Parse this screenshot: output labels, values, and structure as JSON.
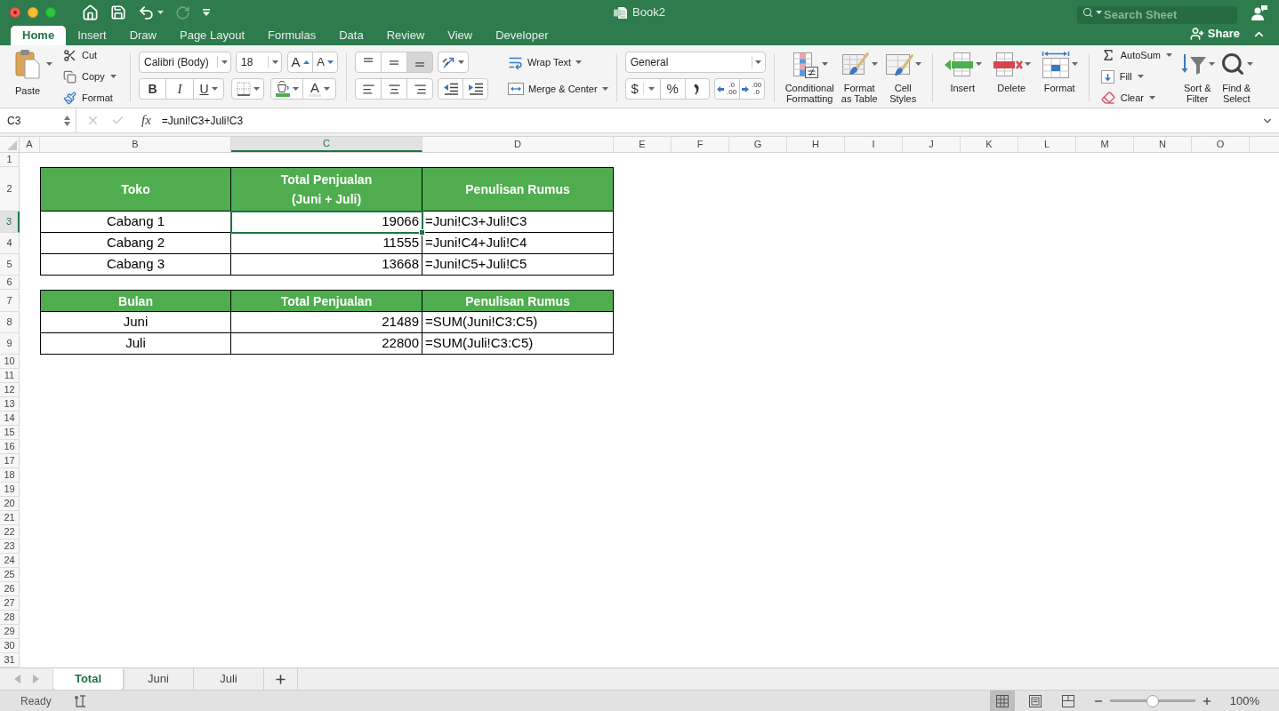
{
  "window": {
    "title": "Book2"
  },
  "quick_access": [
    {
      "kind": "home",
      "disabled": false
    },
    {
      "kind": "save",
      "disabled": false
    },
    {
      "kind": "undo",
      "disabled": false
    },
    {
      "kind": "redo",
      "disabled": true
    },
    {
      "kind": "customize",
      "disabled": false
    }
  ],
  "search": {
    "placeholder": "Search Sheet"
  },
  "share": {
    "label": "Share"
  },
  "ribbon_tabs": [
    {
      "label": "Home",
      "selected": true
    },
    {
      "label": "Insert",
      "selected": false
    },
    {
      "label": "Draw",
      "selected": false
    },
    {
      "label": "Page Layout",
      "selected": false
    },
    {
      "label": "Formulas",
      "selected": false
    },
    {
      "label": "Data",
      "selected": false
    },
    {
      "label": "Review",
      "selected": false
    },
    {
      "label": "View",
      "selected": false
    },
    {
      "label": "Developer",
      "selected": false
    }
  ],
  "clipboard": {
    "paste": "Paste",
    "cut": "Cut",
    "copy": "Copy",
    "format": "Format"
  },
  "font": {
    "name": "Calibri (Body)",
    "size": "18",
    "grow": "A",
    "shrink": "A",
    "bold": "B",
    "italic": "I",
    "underline": "U",
    "foreground": "A"
  },
  "alignment": {
    "vertical": [
      {
        "kind": "top",
        "selected": false
      },
      {
        "kind": "middle",
        "selected": false
      },
      {
        "kind": "bottom",
        "selected": true
      }
    ],
    "horizontal": [
      {
        "kind": "left",
        "selected": false
      },
      {
        "kind": "center",
        "selected": false
      },
      {
        "kind": "right",
        "selected": false
      }
    ],
    "wrap_text": "Wrap Text",
    "merge": "Merge & Center"
  },
  "number": {
    "format": "General",
    "currency": "$",
    "percent": "%",
    "increase_decimal": [
      ".0",
      ".00"
    ],
    "decrease_decimal": [
      ".00",
      ".0"
    ]
  },
  "styles": [
    {
      "kind": "conditional",
      "label": "Conditional\nFormatting"
    },
    {
      "kind": "table",
      "label": "Format\nas Table"
    },
    {
      "kind": "cell",
      "label": "Cell\nStyles"
    }
  ],
  "cells": [
    {
      "kind": "insert",
      "label": "Insert"
    },
    {
      "kind": "delete",
      "label": "Delete"
    },
    {
      "kind": "format",
      "label": "Format"
    }
  ],
  "editing": {
    "autosum": "AutoSum",
    "fill": "Fill",
    "clear": "Clear",
    "sort": "Sort &\nFilter",
    "find": "Find &\nSelect"
  },
  "formula_bar": {
    "name_box": "C3",
    "function_label": "fx",
    "formula": "=Juni!C3+Juli!C3"
  },
  "sheet": {
    "columns": [
      {
        "label": "A",
        "selected": false
      },
      {
        "label": "B",
        "selected": false
      },
      {
        "label": "C",
        "selected": true
      },
      {
        "label": "D",
        "selected": false
      },
      {
        "label": "E",
        "selected": false
      },
      {
        "label": "F",
        "selected": false
      },
      {
        "label": "G",
        "selected": false
      },
      {
        "label": "H",
        "selected": false
      },
      {
        "label": "I",
        "selected": false
      },
      {
        "label": "J",
        "selected": false
      },
      {
        "label": "K",
        "selected": false
      },
      {
        "label": "L",
        "selected": false
      },
      {
        "label": "M",
        "selected": false
      },
      {
        "label": "N",
        "selected": false
      },
      {
        "label": "O",
        "selected": false
      }
    ],
    "rows": [
      {
        "label": "1",
        "selected": false
      },
      {
        "label": "2",
        "selected": false
      },
      {
        "label": "3",
        "selected": true
      },
      {
        "label": "4",
        "selected": false
      },
      {
        "label": "5",
        "selected": false
      },
      {
        "label": "6",
        "selected": false
      },
      {
        "label": "7",
        "selected": false
      },
      {
        "label": "8",
        "selected": false
      },
      {
        "label": "9",
        "selected": false
      },
      {
        "label": "10",
        "selected": false
      },
      {
        "label": "11",
        "selected": false
      },
      {
        "label": "12",
        "selected": false
      },
      {
        "label": "13",
        "selected": false
      },
      {
        "label": "14",
        "selected": false
      },
      {
        "label": "15",
        "selected": false
      },
      {
        "label": "16",
        "selected": false
      },
      {
        "label": "17",
        "selected": false
      },
      {
        "label": "18",
        "selected": false
      },
      {
        "label": "19",
        "selected": false
      },
      {
        "label": "20",
        "selected": false
      },
      {
        "label": "21",
        "selected": false
      },
      {
        "label": "22",
        "selected": false
      },
      {
        "label": "23",
        "selected": false
      },
      {
        "label": "24",
        "selected": false
      },
      {
        "label": "25",
        "selected": false
      },
      {
        "label": "26",
        "selected": false
      },
      {
        "label": "27",
        "selected": false
      },
      {
        "label": "28",
        "selected": false
      },
      {
        "label": "29",
        "selected": false
      },
      {
        "label": "30",
        "selected": false
      },
      {
        "label": "31",
        "selected": false
      }
    ],
    "tables": [
      {
        "header": [
          {
            "text": "Toko",
            "selected": false
          },
          {
            "text": "Total Penjualan\n(Juni + Juli)",
            "selected": false
          },
          {
            "text": "Penulisan Rumus",
            "selected": false
          }
        ],
        "rows": [
          [
            {
              "text": "Cabang 1",
              "selected": false
            },
            {
              "text": "19066",
              "selected": true
            },
            {
              "text": "=Juni!C3+Juli!C3",
              "selected": false
            }
          ],
          [
            {
              "text": "Cabang 2",
              "selected": false
            },
            {
              "text": "11555",
              "selected": false
            },
            {
              "text": "=Juni!C4+Juli!C4",
              "selected": false
            }
          ],
          [
            {
              "text": "Cabang 3",
              "selected": false
            },
            {
              "text": "13668",
              "selected": false
            },
            {
              "text": "=Juni!C5+Juli!C5",
              "selected": false
            }
          ]
        ]
      },
      {
        "header": [
          {
            "text": "Bulan",
            "selected": false
          },
          {
            "text": "Total Penjualan",
            "selected": false
          },
          {
            "text": "Penulisan Rumus",
            "selected": false
          }
        ],
        "rows": [
          [
            {
              "text": "Juni",
              "selected": false
            },
            {
              "text": "21489",
              "selected": false
            },
            {
              "text": "=SUM(Juni!C3:C5)",
              "selected": false
            }
          ],
          [
            {
              "text": "Juli",
              "selected": false
            },
            {
              "text": "22800",
              "selected": false
            },
            {
              "text": "=SUM(Juli!C3:C5)",
              "selected": false
            }
          ]
        ]
      }
    ]
  },
  "sheet_tabs": [
    {
      "label": "Total",
      "selected": true
    },
    {
      "label": "Juni",
      "selected": false
    },
    {
      "label": "Juli",
      "selected": false
    }
  ],
  "status_bar": {
    "status": "Ready",
    "views": [
      {
        "kind": "normal",
        "selected": true
      },
      {
        "kind": "page_layout",
        "selected": false
      },
      {
        "kind": "page_break",
        "selected": false
      }
    ],
    "zoom": {
      "level": 0.5,
      "reading": "100%"
    }
  }
}
